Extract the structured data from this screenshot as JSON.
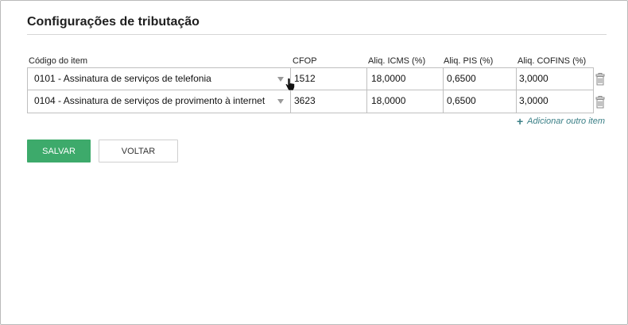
{
  "page": {
    "title": "Configurações de tributação"
  },
  "table": {
    "headers": {
      "code": "Código do item",
      "cfop": "CFOP",
      "icms": "Aliq. ICMS (%)",
      "pis": "Aliq. PIS (%)",
      "cofins": "Aliq. COFINS (%)"
    },
    "rows": [
      {
        "code": "0101 - Assinatura de serviços de telefonia",
        "cfop": "1512",
        "icms": "18,0000",
        "pis": "0,6500",
        "cofins": "3,0000"
      },
      {
        "code": "0104 - Assinatura de serviços de provimento à internet",
        "cfop": "3623",
        "icms": "18,0000",
        "pis": "0,6500",
        "cofins": "3,0000"
      }
    ],
    "add_item_label": "Adicionar outro item"
  },
  "actions": {
    "save_label": "SALVAR",
    "back_label": "VOLTAR"
  },
  "colors": {
    "save_button": "#3daa6b",
    "link": "#3a7f86"
  },
  "icons": {
    "row_delete": "trash-icon",
    "dropdown": "chevron-down-icon",
    "add": "plus-icon",
    "pointer": "hand-cursor-icon"
  }
}
